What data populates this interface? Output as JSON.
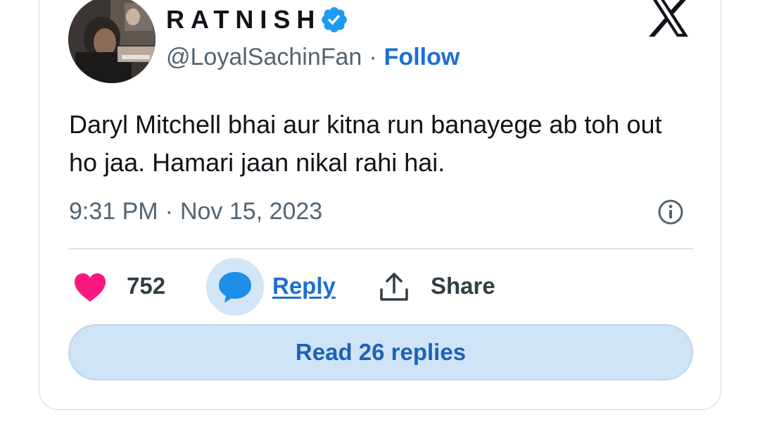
{
  "author": {
    "display_name": "RATNISH",
    "handle": "@LoyalSachinFan",
    "separator": "·",
    "follow_label": "Follow",
    "verified": true
  },
  "tweet": {
    "text": "Daryl Mitchell bhai aur kitna run banayege ab toh out ho jaa. Hamari jaan nikal rahi hai.",
    "time": "9:31 PM",
    "separator": "·",
    "date": "Nov 15, 2023"
  },
  "actions": {
    "like_count": "752",
    "reply_label": "Reply",
    "share_label": "Share",
    "read_replies_label": "Read 26 replies"
  },
  "icons": {
    "logo": "x-logo-icon",
    "verified": "verified-badge-icon",
    "info": "info-icon",
    "like": "heart-icon",
    "reply": "speech-bubble-icon",
    "share": "upload-share-icon"
  },
  "colors": {
    "accent": "#1d6fd1",
    "heart": "#f91880",
    "reply_bg": "#d2e6f7",
    "read_replies_bg": "#cfe4f6",
    "secondary_text": "#536471"
  }
}
